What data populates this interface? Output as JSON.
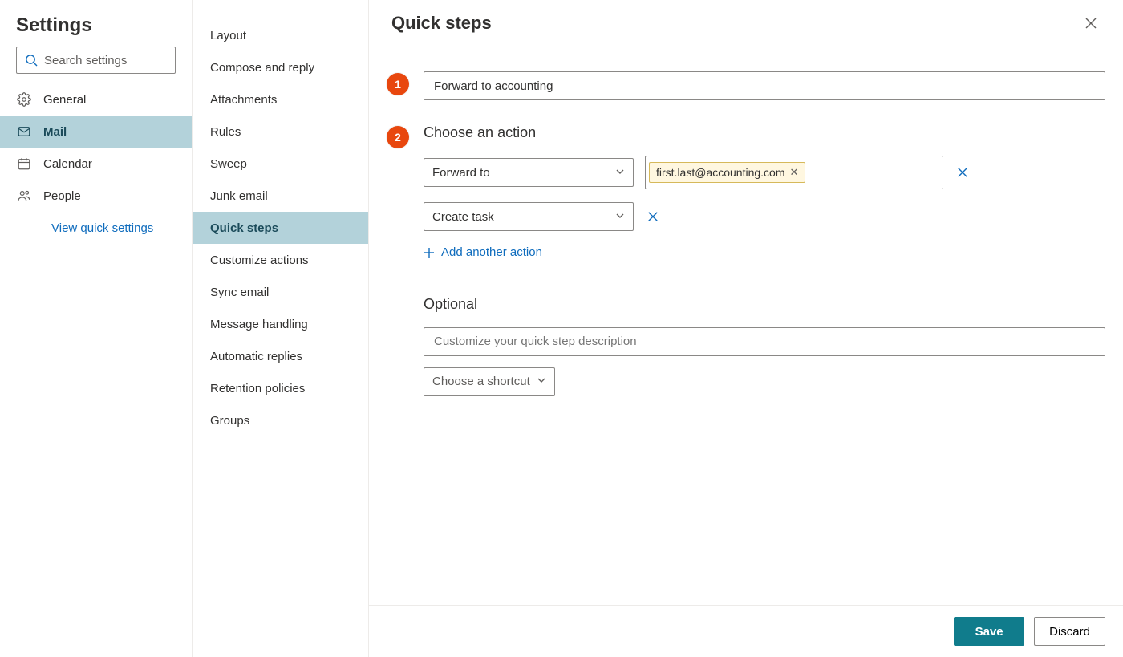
{
  "settings": {
    "title": "Settings",
    "search_placeholder": "Search settings",
    "nav": [
      {
        "label": "General"
      },
      {
        "label": "Mail"
      },
      {
        "label": "Calendar"
      },
      {
        "label": "People"
      }
    ],
    "quick_link": "View quick settings"
  },
  "mail_sub": [
    "Layout",
    "Compose and reply",
    "Attachments",
    "Rules",
    "Sweep",
    "Junk email",
    "Quick steps",
    "Customize actions",
    "Sync email",
    "Message handling",
    "Automatic replies",
    "Retention policies",
    "Groups"
  ],
  "main": {
    "title": "Quick steps",
    "step1_badge": "1",
    "step1_name": "Forward to accounting",
    "step2_badge": "2",
    "step2_label": "Choose an action",
    "actions": [
      {
        "select": "Forward to",
        "recipient": "first.last@accounting.com"
      },
      {
        "select": "Create task"
      }
    ],
    "add_action": "Add another action",
    "optional_label": "Optional",
    "description_placeholder": "Customize your quick step description",
    "shortcut_placeholder": "Choose a shortcut",
    "save": "Save",
    "discard": "Discard"
  }
}
